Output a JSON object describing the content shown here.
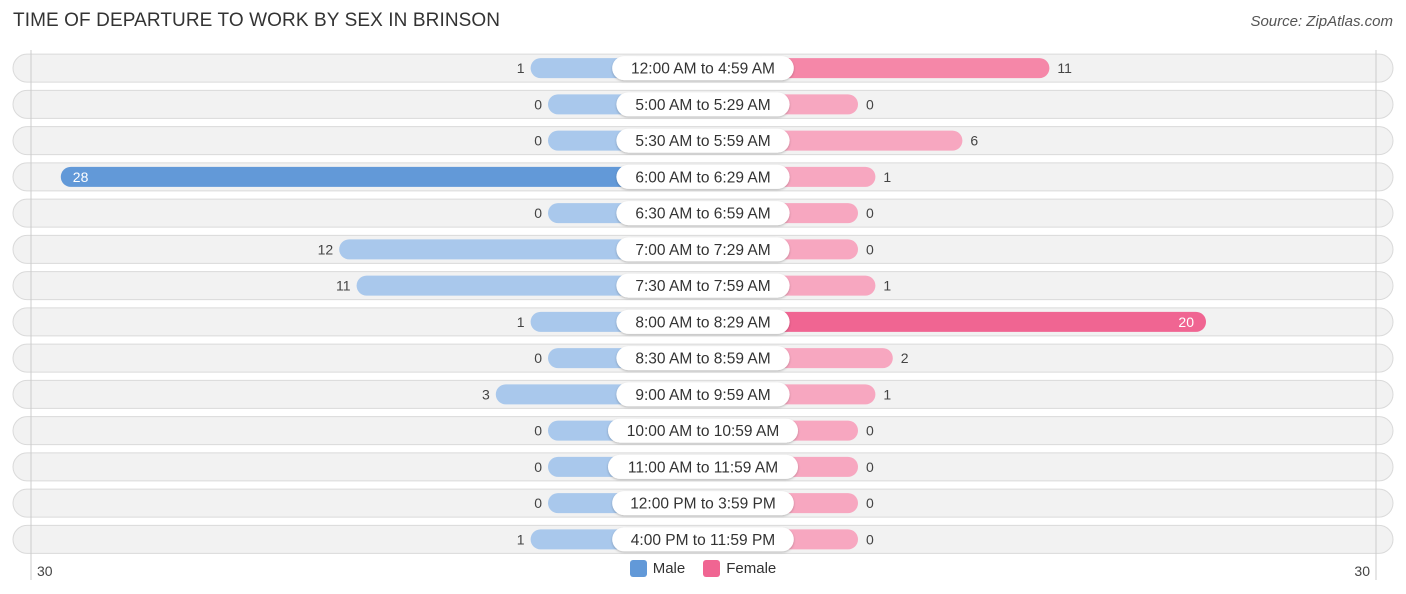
{
  "title": "TIME OF DEPARTURE TO WORK BY SEX IN BRINSON",
  "source": "Source: ZipAtlas.com",
  "colors": {
    "male_strong": "#6299d8",
    "male_light": "#a9c8ec",
    "female_strong": "#f06592",
    "female_medium": "#f587a8",
    "female_light": "#f7a7c0"
  },
  "chart_data": {
    "type": "bar",
    "orientation": "horizontal-diverging",
    "title": "TIME OF DEPARTURE TO WORK BY SEX IN BRINSON",
    "categories": [
      "12:00 AM to 4:59 AM",
      "5:00 AM to 5:29 AM",
      "5:30 AM to 5:59 AM",
      "6:00 AM to 6:29 AM",
      "6:30 AM to 6:59 AM",
      "7:00 AM to 7:29 AM",
      "7:30 AM to 7:59 AM",
      "8:00 AM to 8:29 AM",
      "8:30 AM to 8:59 AM",
      "9:00 AM to 9:59 AM",
      "10:00 AM to 10:59 AM",
      "11:00 AM to 11:59 AM",
      "12:00 PM to 3:59 PM",
      "4:00 PM to 11:59 PM"
    ],
    "series": [
      {
        "name": "Male",
        "values": [
          1,
          0,
          0,
          28,
          0,
          12,
          11,
          1,
          0,
          3,
          0,
          0,
          0,
          1
        ]
      },
      {
        "name": "Female",
        "values": [
          11,
          0,
          6,
          1,
          0,
          0,
          1,
          20,
          2,
          1,
          0,
          0,
          0,
          0
        ]
      }
    ],
    "xlim": [
      -30,
      30
    ],
    "tick_labels": {
      "left": "30",
      "right": "30"
    },
    "legend": {
      "entries": [
        "Male",
        "Female"
      ],
      "position": "bottom-center"
    },
    "grid": false
  }
}
